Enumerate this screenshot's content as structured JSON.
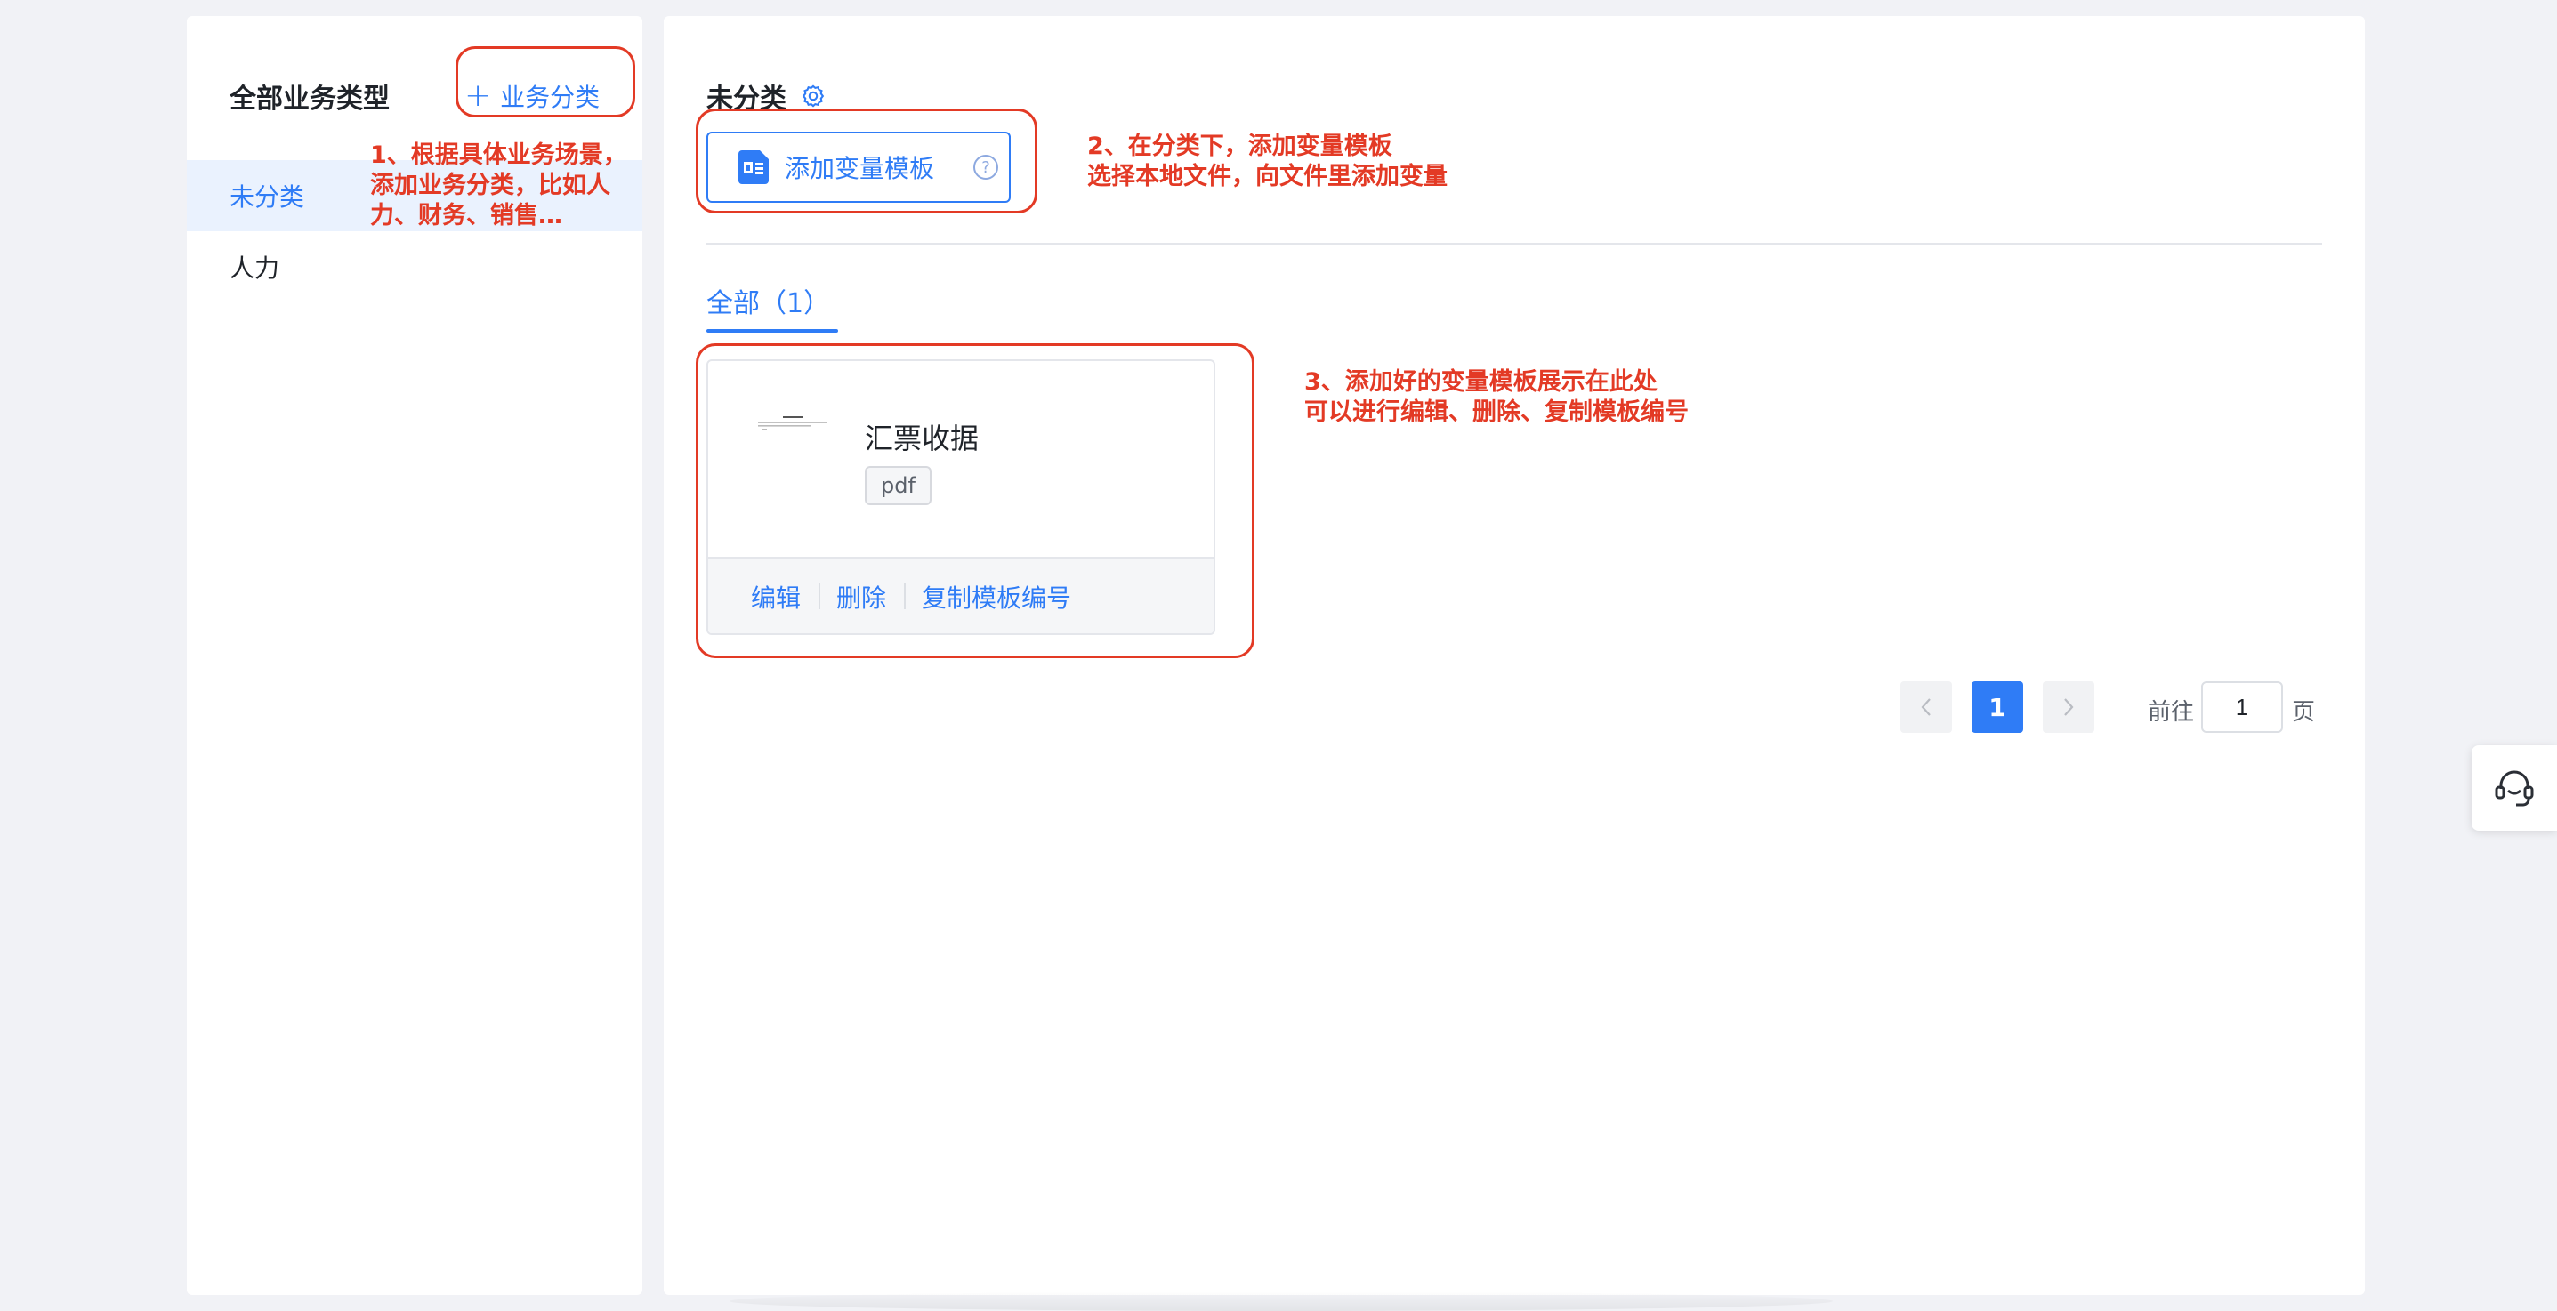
{
  "sidebar": {
    "title": "全部业务类型",
    "add_button_label": "业务分类",
    "items": [
      {
        "label": "未分类",
        "active": true
      },
      {
        "label": "人力",
        "active": false
      }
    ]
  },
  "main": {
    "title": "未分类",
    "add_template_label": "添加变量模板",
    "help_icon_glyph": "?",
    "tabs": [
      {
        "label": "全部（1）",
        "active": true
      }
    ],
    "templates": [
      {
        "name": "汇票收据",
        "file_type": "pdf",
        "actions": [
          "编辑",
          "删除",
          "复制模板编号"
        ]
      }
    ]
  },
  "pagination": {
    "current_page": "1",
    "goto_prefix": "前往",
    "goto_value": "1",
    "goto_suffix": "页"
  },
  "annotations": {
    "note1": "1、根据具体业务场景，\n添加业务分类，比如人\n力、财务、销售…",
    "note2": "2、在分类下，添加变量模板\n选择本地文件，向文件里添加变量",
    "note3": "3、添加好的变量模板展示在此处\n可以进行编辑、删除、复制模板编号"
  },
  "colors": {
    "accent": "#2f7cf6",
    "annotation": "#e33a25",
    "background": "#f1f2f6"
  },
  "icons": {
    "add": "plus-icon",
    "settings": "gear-icon",
    "template": "document-icon",
    "help": "help-circle-icon",
    "prev": "chevron-left-icon",
    "next": "chevron-right-icon",
    "support": "headset-icon"
  }
}
